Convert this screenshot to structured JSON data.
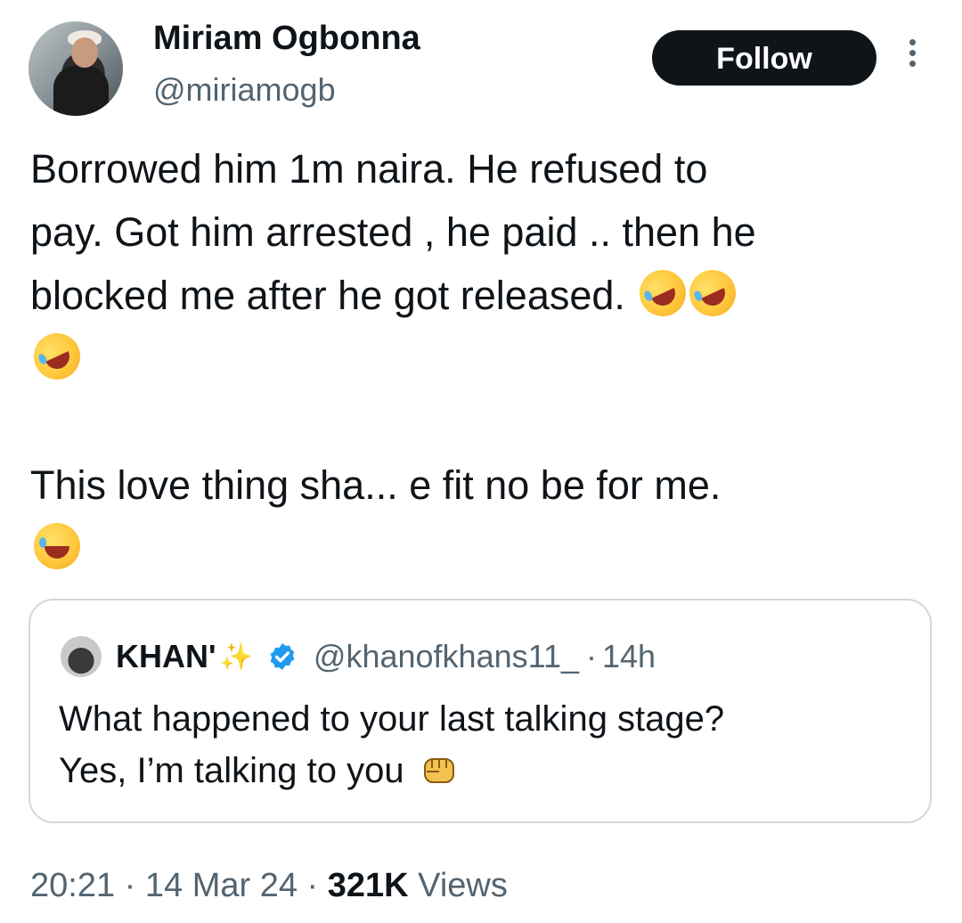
{
  "author": {
    "name": "Miriam Ogbonna",
    "handle": "@miriamogb"
  },
  "follow_label": "Follow",
  "tweet": {
    "line1": "Borrowed him 1m naira. He refused to",
    "line2": "pay. Got him arrested , he paid .. then he",
    "line3": "blocked me after he got released.",
    "line4": "This love thing sha... e fit no be for me.",
    "emojis": [
      "rofl-emoji",
      "rofl-emoji",
      "rofl-emoji",
      "tears-of-joy-emoji"
    ]
  },
  "quoted_tweet": {
    "name": "KHAN'",
    "handle": "@khanofkhans11_",
    "separator": "·",
    "time": "14h",
    "line1": "What happened to your last talking stage?",
    "line2": "Yes, I’m talking to you"
  },
  "meta": {
    "time": "20:21",
    "separator": "·",
    "date": "14 Mar 24",
    "views_count": "321K",
    "views_label": "Views"
  },
  "colors": {
    "text": "#0f1419",
    "secondary": "#536471",
    "border": "#cfd9de",
    "verified": "#1d9bf0",
    "button_bg": "#0f1419"
  }
}
